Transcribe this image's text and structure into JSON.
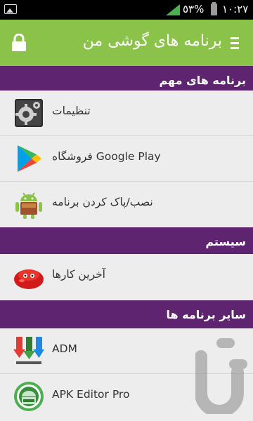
{
  "status_bar": {
    "battery_percent": "٥٣%",
    "time": "١٠:٢٧"
  },
  "app_bar": {
    "title": "برنامه های گوشی من"
  },
  "sections": [
    {
      "title": "برنامه های مهم",
      "items": [
        {
          "label": "تنظیمات",
          "icon": "settings-gear-icon"
        },
        {
          "label": "فروشگاه Google Play",
          "icon": "google-play-icon"
        },
        {
          "label": "نصب/پاک کردن برنامه",
          "icon": "android-package-icon"
        }
      ]
    },
    {
      "title": "سیستم",
      "items": [
        {
          "label": "آخرین کارها",
          "icon": "jelly-bean-icon"
        }
      ]
    },
    {
      "title": "سایر برنامه ها",
      "items": [
        {
          "label": "ADM",
          "icon": "adm-download-icon"
        },
        {
          "label": "APK Editor Pro",
          "icon": "apk-editor-icon"
        }
      ]
    }
  ],
  "colors": {
    "app_bar": "#8bc34a",
    "section_header": "#5f2470",
    "background": "#ededed"
  }
}
